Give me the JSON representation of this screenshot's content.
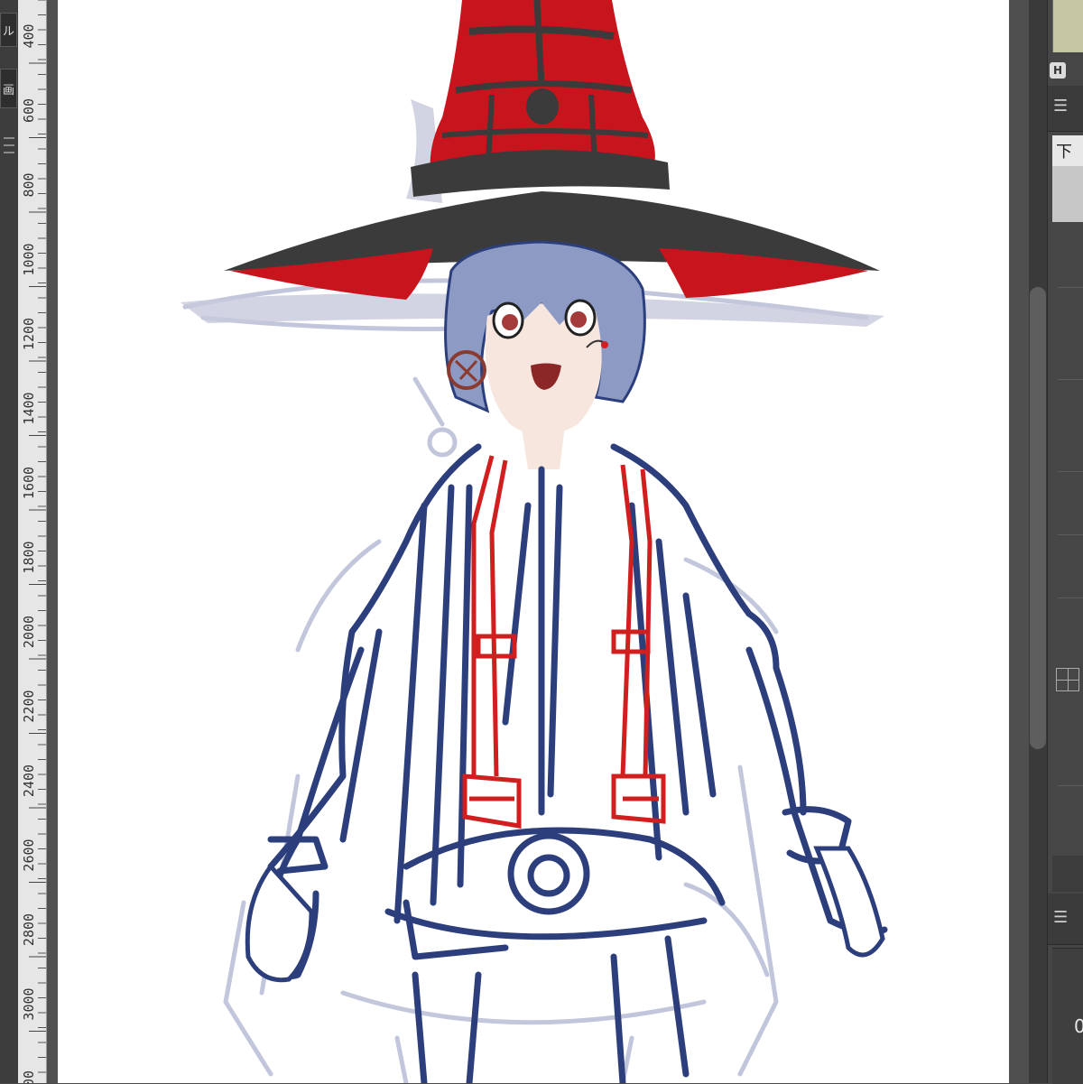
{
  "toolbar": {
    "button_1_label": "ル",
    "button_2_label": "画"
  },
  "ruler": {
    "ticks": [
      "400",
      "600",
      "800",
      "1000",
      "1200",
      "1400",
      "1600",
      "1800",
      "2000",
      "2200",
      "2400",
      "2600",
      "2800",
      "3000",
      "00"
    ]
  },
  "layer_panel": {
    "active_layer_label": "下"
  },
  "navigator": {
    "icon_letter": "H",
    "value_text": "0"
  },
  "colors": {
    "hat_red": "#c8141c",
    "hat_black": "#3b3b3b",
    "sketch_blue": "#2c3f7c",
    "strap_red": "#d11e1e",
    "hair": "#8d9bc4",
    "skin": "#f7e6dd"
  }
}
